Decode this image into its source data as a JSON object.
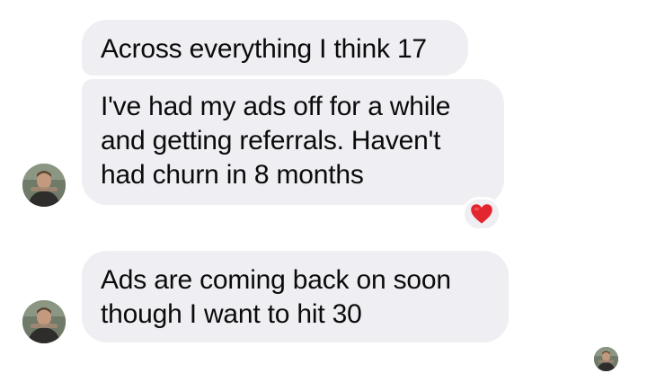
{
  "messages": [
    {
      "id": "m1",
      "lines": [
        "Across everything I think 17"
      ]
    },
    {
      "id": "m2",
      "lines": [
        "I've had my ads off for a while",
        "and getting referrals. Haven't",
        "had churn in 8 months"
      ],
      "reaction": "heart-icon"
    },
    {
      "id": "m3",
      "lines": [
        "Ads are coming back on soon",
        "though I want to hit 30"
      ]
    }
  ],
  "colors": {
    "bubble": "#eeeef3",
    "text": "#0b0b0b",
    "heart": "#e3262e",
    "background": "#ffffff"
  },
  "avatars": [
    "sender-avatar",
    "sender-avatar",
    "read-receipt-avatar"
  ]
}
